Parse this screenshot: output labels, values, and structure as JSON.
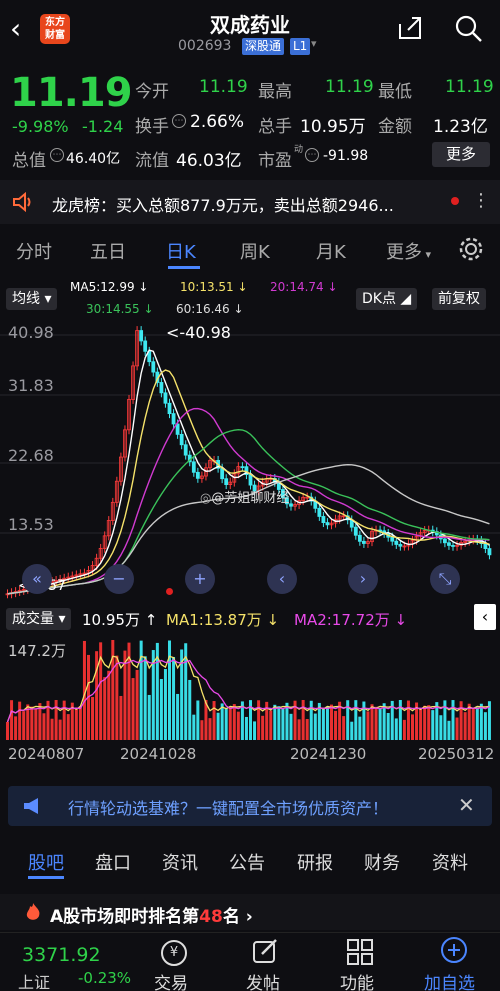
{
  "header": {
    "back_icon": "back-arrow-icon",
    "logo_line1": "东方",
    "logo_line2": "财富",
    "stock_name": "双成药业",
    "stock_code": "002693",
    "badge": "深股通",
    "level": "L1"
  },
  "quote": {
    "price": "11.19",
    "change_pct": "-9.98%",
    "change_val": "-1.24",
    "open_label": "今开",
    "open": "11.19",
    "high_label": "最高",
    "high": "11.19",
    "low_label": "最低",
    "low": "11.19",
    "turnover_label": "换手",
    "turnover": "2.66%",
    "volume_label": "总手",
    "volume": "10.95万",
    "amount_label": "金额",
    "amount": "1.23亿",
    "mktcap_label": "总值",
    "mktcap": "46.40亿",
    "float_label": "流值",
    "float": "46.03亿",
    "pe_label": "市盈",
    "pe_sup": "动",
    "pe": "-91.98",
    "more": "更多"
  },
  "dragon": {
    "text": "龙虎榜：买入总额877.9万元，卖出总额2946..."
  },
  "tabs": [
    "分时",
    "五日",
    "日K",
    "周K",
    "月K",
    "更多"
  ],
  "active_tab": "日K",
  "ma": {
    "btn_left": "均线",
    "ma5": "MA5:12.99 ↓",
    "ma10": "10:13.51 ↓",
    "ma20": "20:14.74 ↓",
    "ma30": "30:14.55 ↓",
    "ma60": "60:16.46 ↓",
    "dk": "DK点",
    "fq": "前复权"
  },
  "chart": {
    "y_labels": [
      "40.98",
      "31.83",
      "22.68",
      "13.53"
    ],
    "max_note": "<-40.98",
    "min_note": "<-4.57",
    "watermark": "@芳姐聊财经"
  },
  "volume": {
    "label": "成交量",
    "vol": "10.95万 ↑",
    "ma1": "MA1:13.87万 ↓",
    "ma2": "MA2:17.72万 ↓",
    "max": "147.2万"
  },
  "dates": [
    "20240807",
    "20241028",
    "20241230",
    "20250312"
  ],
  "banner": {
    "text": "行情轮动选基难？一键配置全市场优质资产！"
  },
  "bottom_tabs": [
    "股吧",
    "盘口",
    "资讯",
    "公告",
    "研报",
    "财务",
    "资料"
  ],
  "rank": {
    "pre": "A股市场即时排名第",
    "num": "48",
    "post": "名 ›"
  },
  "footer": {
    "index": "3371.92",
    "index_name": "上证",
    "index_chg": "-0.23%",
    "items": [
      "交易",
      "发帖",
      "功能",
      "加自选"
    ]
  },
  "colors": {
    "down": "#2fd24a",
    "up": "#ff3b3b",
    "accent": "#4b86ff",
    "ma5": "#ffffff",
    "ma10": "#f5e26a",
    "ma20": "#d03ad0",
    "ma30": "#3ac25a",
    "ma60": "#c8c8c8"
  }
}
